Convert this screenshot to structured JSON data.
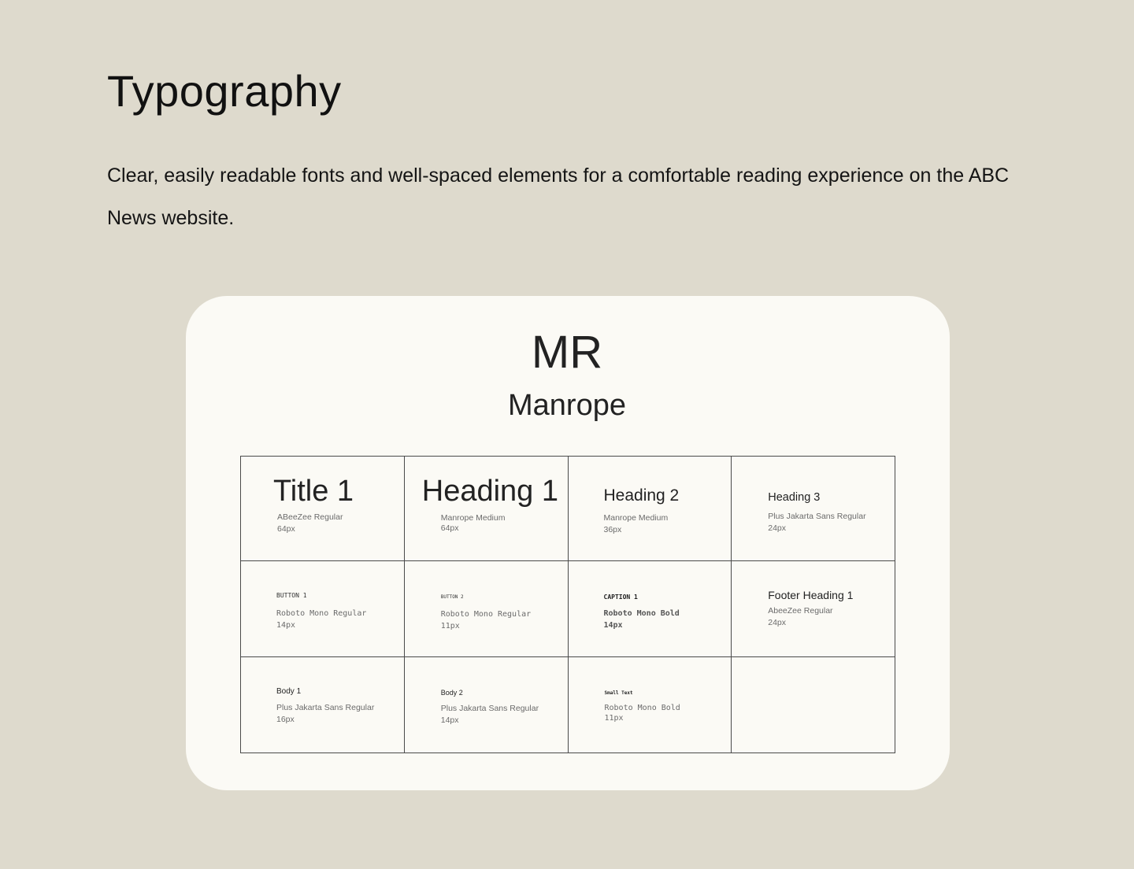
{
  "header": {
    "title": "Typography",
    "description": "Clear, easily readable fonts and well-spaced elements for a comfortable reading experience on the ABC News website."
  },
  "card": {
    "abbreviation": "MR",
    "family_name": "Manrope"
  },
  "styles": [
    {
      "sample": "Title 1",
      "font": "ABeeZee Regular",
      "size": "64px"
    },
    {
      "sample": "Heading 1",
      "font": "Manrope Medium",
      "size": "64px"
    },
    {
      "sample": "Heading 2",
      "font": "Manrope Medium",
      "size": "36px"
    },
    {
      "sample": "Heading 3",
      "font": "Plus Jakarta Sans Regular",
      "size": "24px"
    },
    {
      "sample": "BUTTON 1",
      "font": "Roboto Mono Regular",
      "size": "14px"
    },
    {
      "sample": "BUTTON 2",
      "font": "Roboto Mono Regular",
      "size": "11px"
    },
    {
      "sample": "CAPTION 1",
      "font": "Roboto Mono Bold",
      "size": "14px"
    },
    {
      "sample": "Footer Heading 1",
      "font": "AbeeZee Regular",
      "size": "24px"
    },
    {
      "sample": "Body 1",
      "font": "Plus Jakarta Sans Regular",
      "size": "16px"
    },
    {
      "sample": "Body 2",
      "font": "Plus Jakarta Sans Regular",
      "size": "14px"
    },
    {
      "sample": "Small Text",
      "font": "Roboto Mono Bold",
      "size": "11px"
    }
  ]
}
